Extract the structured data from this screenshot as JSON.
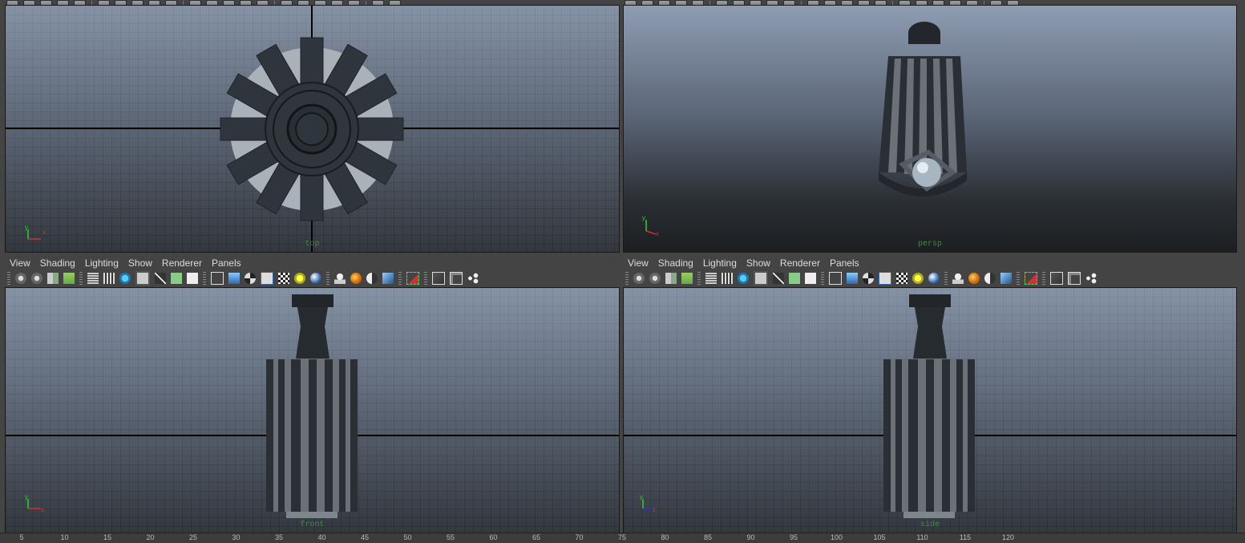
{
  "menu": [
    "View",
    "Shading",
    "Lighting",
    "Show",
    "Renderer",
    "Panels"
  ],
  "viewports": {
    "top_left": {
      "camera": "top"
    },
    "top_right": {
      "camera": "persp"
    },
    "bottom_left": {
      "camera": "front"
    },
    "bottom_right": {
      "camera": "side"
    }
  },
  "axis_labels": {
    "x": "x",
    "y": "y",
    "z": "z"
  },
  "timeline_ticks": [
    "5",
    "10",
    "15",
    "20",
    "25",
    "30",
    "35",
    "40",
    "45",
    "50",
    "55",
    "60",
    "65",
    "70",
    "75",
    "80",
    "85",
    "90",
    "95",
    "100",
    "105",
    "110",
    "115",
    "120"
  ],
  "colors": {
    "grid": "#6f7a88",
    "mesh": "#2f353c",
    "mesh_light": "#8a9096",
    "accent_green": "#3f8a3f"
  }
}
